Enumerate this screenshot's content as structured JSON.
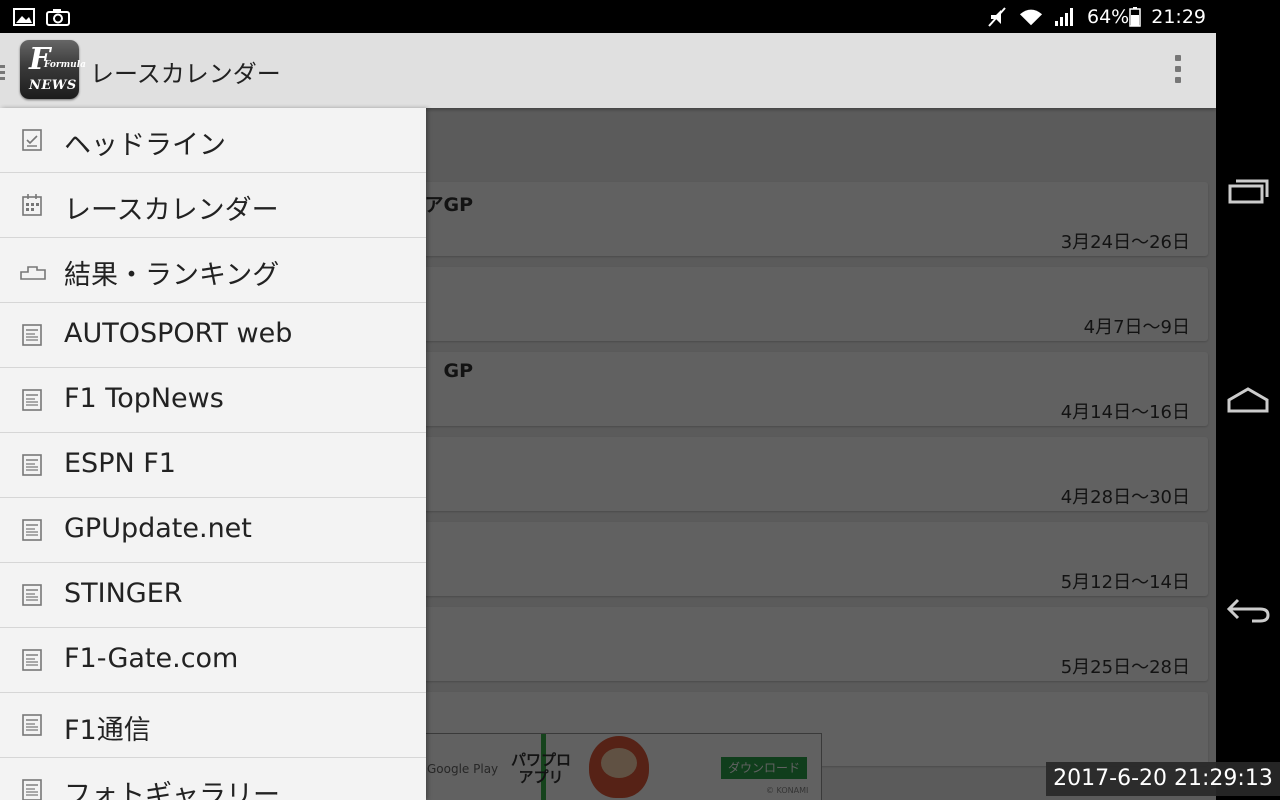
{
  "status_bar": {
    "battery": "64%",
    "time": "21:29"
  },
  "app_bar": {
    "logo_big": "F",
    "logo_small_top": "Formula",
    "logo_small_bottom": "NEWS",
    "title": "レースカレンダー"
  },
  "cards": [
    {
      "title": "アGP",
      "date": "3月24日〜26日"
    },
    {
      "title": "",
      "date": "4月7日〜9日"
    },
    {
      "title": "GP",
      "date": "4月14日〜16日"
    },
    {
      "title": "",
      "date": "4月28日〜30日"
    },
    {
      "title": "",
      "date": "5月12日〜14日"
    },
    {
      "title": "",
      "date": "5月25日〜28日"
    },
    {
      "title": "",
      "date": ""
    }
  ],
  "drawer": {
    "items": [
      {
        "label": "ヘッドライン",
        "icon": "checklist-icon"
      },
      {
        "label": "レースカレンダー",
        "icon": "calendar-icon"
      },
      {
        "label": "結果・ランキング",
        "icon": "podium-icon"
      },
      {
        "label": "AUTOSPORT web",
        "icon": "news-icon"
      },
      {
        "label": "F1 TopNews",
        "icon": "news-icon"
      },
      {
        "label": "ESPN F1",
        "icon": "news-icon"
      },
      {
        "label": "GPUpdate.net",
        "icon": "news-icon"
      },
      {
        "label": "STINGER",
        "icon": "news-icon"
      },
      {
        "label": "F1-Gate.com",
        "icon": "news-icon"
      },
      {
        "label": "F1通信",
        "icon": "news-icon"
      },
      {
        "label": "フォトギャラリー",
        "icon": "news-icon"
      }
    ]
  },
  "ad": {
    "store": "Google Play",
    "line1": "パワプロ",
    "line2": "アプリ",
    "button": "ダウンロード",
    "copyright": "© KONAMI"
  },
  "timestamp": "2017-6-20 21:29:13"
}
